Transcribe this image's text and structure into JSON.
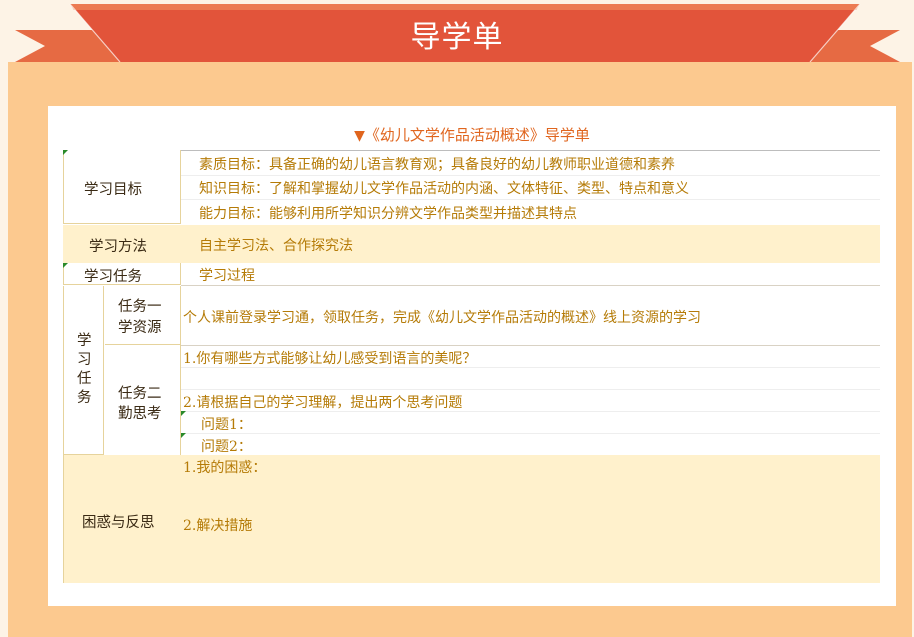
{
  "banner": {
    "title": "导学单"
  },
  "document": {
    "title": "《幼儿文学作品活动概述》导学单",
    "title_marker": "▼",
    "rows": {
      "goals": {
        "label": "学习目标",
        "items": [
          "素质目标：具备正确的幼儿语言教育观；具备良好的幼儿教师职业道德和素养",
          "知识目标：了解和掌握幼儿文学作品活动的内涵、文体特征、类型、特点和意义",
          "能力目标：能够利用所学知识分辨文学作品类型并描述其特点"
        ]
      },
      "methods": {
        "label": "学习方法",
        "value": "自主学习法、合作探究法"
      },
      "tasks_header": {
        "label": "学习任务",
        "value": "学习过程"
      },
      "tasks": {
        "label": "学习任务",
        "label_chars": [
          "学",
          "习",
          "任",
          "务"
        ],
        "task1": {
          "label_line1": "任务一",
          "label_line2": "学资源",
          "content": "个人课前登录学习通，领取任务，完成《幼儿文学作品活动的概述》线上资源的学习"
        },
        "task2": {
          "label_line1": "任务二",
          "label_line2": "勤思考",
          "q1": "1.你有哪些方式能够让幼儿感受到语言的美呢？",
          "q2": "2.请根据自己的学习理解，提出两个思考问题",
          "sub1": "问题1：",
          "sub2": "问题2："
        }
      },
      "reflection": {
        "label": "困惑与反思",
        "item1": "1.我的困惑：",
        "item2": "2.解决措施"
      }
    }
  },
  "colors": {
    "banner_red": "#e2543a",
    "frame_orange": "#fcc98f",
    "row_highlight": "#fff1cc",
    "title_orange": "#e0651e",
    "text_gold": "#b57b07"
  }
}
